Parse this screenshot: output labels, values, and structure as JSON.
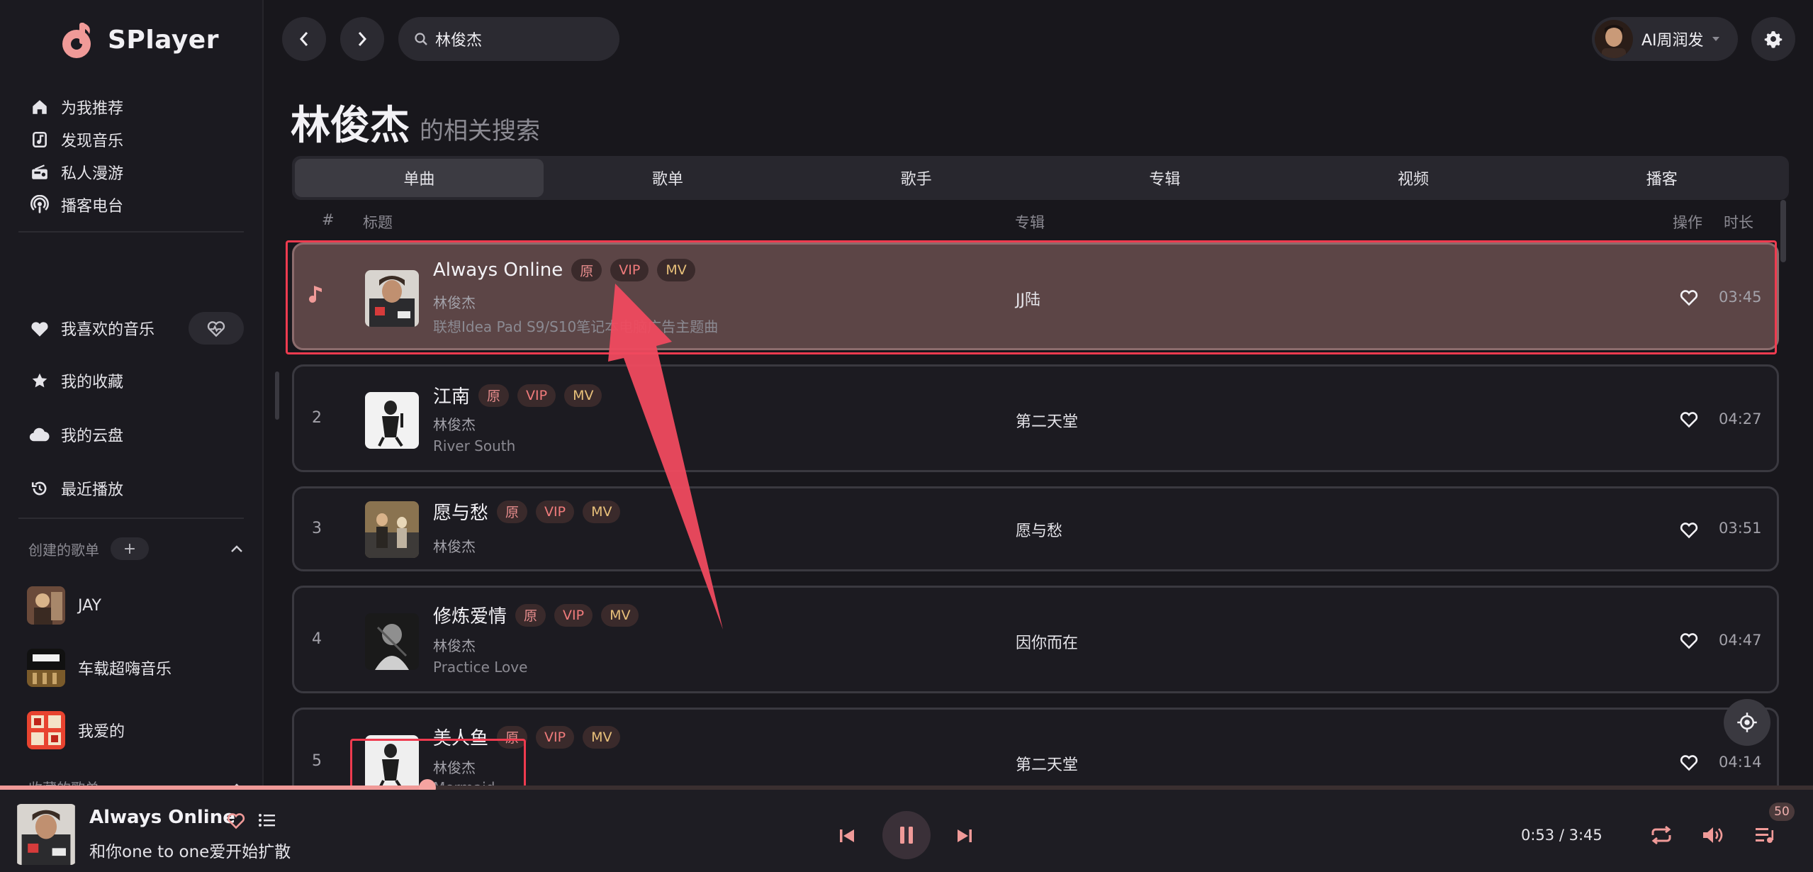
{
  "app": {
    "name": "SPlayer",
    "accent": "#f09a98"
  },
  "sidebar": {
    "nav": [
      {
        "label": "为我推荐",
        "icon": "home-icon"
      },
      {
        "label": "发现音乐",
        "icon": "music-library-icon"
      },
      {
        "label": "私人漫游",
        "icon": "radio-icon"
      },
      {
        "label": "播客电台",
        "icon": "podcast-icon"
      }
    ],
    "library": [
      {
        "label": "我喜欢的音乐",
        "icon": "heart-icon"
      },
      {
        "label": "我的收藏",
        "icon": "star-icon"
      },
      {
        "label": "我的云盘",
        "icon": "cloud-icon"
      },
      {
        "label": "最近播放",
        "icon": "history-icon"
      }
    ],
    "created_section": {
      "label": "创建的歌单",
      "add_label": "+"
    },
    "playlists": [
      {
        "label": "JAY"
      },
      {
        "label": "车载超嗨音乐"
      },
      {
        "label": "我爱的"
      }
    ],
    "collected_section": {
      "label": "收藏的歌单"
    }
  },
  "topbar": {
    "search": {
      "value": "林俊杰"
    },
    "user": {
      "name": "AI周润发"
    }
  },
  "search_page": {
    "keyword": "林俊杰",
    "subtitle": "的相关搜索",
    "tabs": [
      {
        "label": "单曲",
        "active": true
      },
      {
        "label": "歌单",
        "active": false
      },
      {
        "label": "歌手",
        "active": false
      },
      {
        "label": "专辑",
        "active": false
      },
      {
        "label": "视频",
        "active": false
      },
      {
        "label": "播客",
        "active": false
      }
    ],
    "columns": {
      "index": "#",
      "title": "标题",
      "album": "专辑",
      "actions": "操作",
      "duration": "时长"
    },
    "badges": {
      "original": "原",
      "vip": "VIP",
      "mv": "MV"
    },
    "songs": [
      {
        "index": "",
        "playing": true,
        "title": "Always Online",
        "artist": "林俊杰",
        "alias": "联想Idea Pad S9/S10笔记本电脑广告主题曲",
        "album": "JJ陆",
        "duration": "03:45"
      },
      {
        "index": "2",
        "playing": false,
        "title": "江南",
        "artist": "林俊杰",
        "alias": "River South",
        "album": "第二天堂",
        "duration": "04:27"
      },
      {
        "index": "3",
        "playing": false,
        "title": "愿与愁",
        "artist": "林俊杰",
        "alias": "",
        "album": "愿与愁",
        "duration": "03:51"
      },
      {
        "index": "4",
        "playing": false,
        "title": "修炼爱情",
        "artist": "林俊杰",
        "alias": "Practice Love",
        "album": "因你而在",
        "duration": "04:47"
      },
      {
        "index": "5",
        "playing": false,
        "title": "美人鱼",
        "artist": "林俊杰",
        "alias": "Mermaid",
        "album": "第二天堂",
        "duration": "04:14"
      }
    ]
  },
  "player": {
    "title": "Always Online",
    "lyric": "和你one to one爱开始扩散",
    "current_time": "0:53",
    "total_time": "3:45",
    "progress": 0.2356,
    "queue_count": "50"
  }
}
